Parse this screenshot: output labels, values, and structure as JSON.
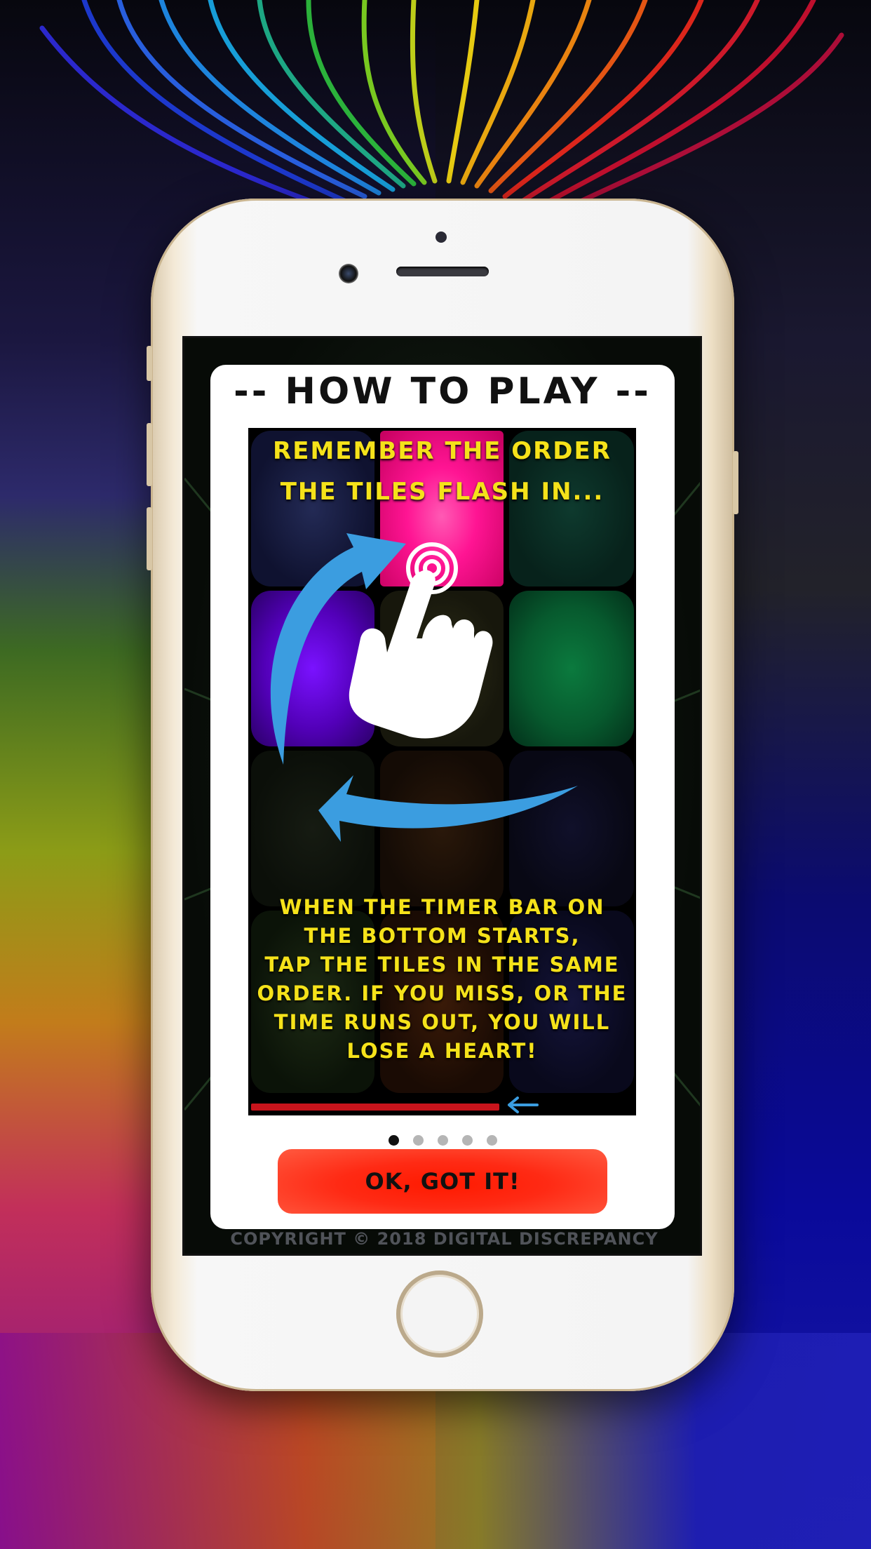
{
  "dialog": {
    "title": "-- HOW TO PLAY --",
    "heading_line1": "REMEMBER THE ORDER",
    "heading_line2": "THE TILES FLASH IN...",
    "body_lines": [
      "WHEN THE TIMER BAR ON",
      "THE BOTTOM STARTS,",
      "TAP THE TILES IN THE SAME",
      "ORDER. IF YOU MISS, OR THE",
      "TIME RUNS OUT, YOU WILL",
      "LOSE A HEART!"
    ],
    "confirm_label": "OK, GOT IT!",
    "pagination": {
      "total": 5,
      "current": 1
    },
    "timer_progress": 0.65
  },
  "footer": {
    "copyright": "COPYRIGHT © 2018 DIGITAL DISCREPANCY"
  },
  "icons": {
    "hand": "hand-tap-icon",
    "tap_target": "tap-ripple-icon",
    "arrows": "curved-arrow-icon",
    "timer_arrow": "left-arrow-icon"
  },
  "colors": {
    "heading_text": "#f5e21a",
    "button": "#ff2a14",
    "tile_pink": "#ff1493",
    "tile_purple": "#6a00d8",
    "tile_green": "#0f6a3a",
    "arrow_blue": "#3b9de0",
    "timer_bar": "#c8141c"
  }
}
